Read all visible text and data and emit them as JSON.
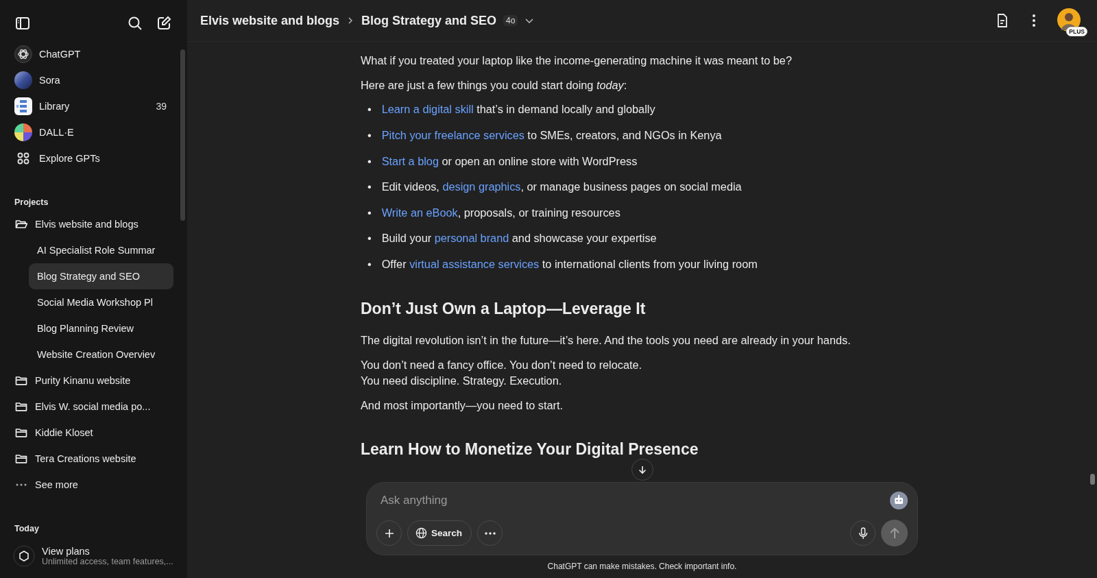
{
  "sidebar": {
    "nav": [
      {
        "kind": "chatgpt",
        "label": "ChatGPT"
      },
      {
        "kind": "sora",
        "label": "Sora"
      },
      {
        "kind": "library",
        "label": "Library",
        "count": "39"
      },
      {
        "kind": "dalle",
        "label": "DALL·E"
      },
      {
        "kind": "explore",
        "label": "Explore GPTs"
      }
    ],
    "projects_heading": "Projects",
    "projects": [
      {
        "label": "Elvis website and blogs",
        "expanded": true,
        "children": [
          {
            "label": "AI Specialist Role Summar",
            "selected": false
          },
          {
            "label": "Blog Strategy and SEO",
            "selected": true
          },
          {
            "label": "Social Media Workshop Pl",
            "selected": false
          },
          {
            "label": "Blog Planning Review",
            "selected": false
          },
          {
            "label": "Website Creation Overviev",
            "selected": false
          }
        ]
      },
      {
        "label": "Purity Kinanu website",
        "expanded": false
      },
      {
        "label": "Elvis W. social media po...",
        "expanded": false
      },
      {
        "label": "Kiddie Kloset",
        "expanded": false
      },
      {
        "label": "Tera Creations website",
        "expanded": false
      }
    ],
    "see_more": "See more",
    "section_heading": "Today",
    "plans": {
      "title": "View plans",
      "subtitle": "Unlimited access, team features,..."
    }
  },
  "header": {
    "breadcrumb": [
      "Elvis website and blogs",
      "Blog Strategy and SEO"
    ],
    "model_badge": "4o",
    "plan_badge": "PLUS"
  },
  "message": [
    {
      "kind": "paragraph",
      "text": "What if you treated your laptop like the income-generating machine it was meant to be?"
    },
    {
      "kind": "paragraph",
      "text": "Here are just a few things you could start doing *today*:"
    },
    {
      "kind": "bullets",
      "marker": "•",
      "items": [
        [
          {
            "text": "Learn a digital skill",
            "link": true
          },
          {
            "text": " that’s in demand locally and globally",
            "link": false
          }
        ],
        [
          {
            "text": "Pitch your freelance services",
            "link": true
          },
          {
            "text": " to SMEs, creators, and NGOs in Kenya",
            "link": false
          }
        ],
        [
          {
            "text": "Start a blog",
            "link": true
          },
          {
            "text": " or open an online store with WordPress",
            "link": false
          }
        ],
        [
          {
            "text": "Edit videos, ",
            "link": false
          },
          {
            "text": "design graphics",
            "link": true
          },
          {
            "text": ", or manage business pages on social media",
            "link": false
          }
        ],
        [
          {
            "text": "Write an eBook",
            "link": true
          },
          {
            "text": ", proposals, or training resources",
            "link": false
          }
        ],
        [
          {
            "text": "Build your ",
            "link": false
          },
          {
            "text": "personal brand",
            "link": true
          },
          {
            "text": " and showcase your expertise",
            "link": false
          }
        ],
        [
          {
            "text": "Offer ",
            "link": false
          },
          {
            "text": "virtual assistance services",
            "link": true
          },
          {
            "text": " to international clients from your living room",
            "link": false
          }
        ]
      ]
    },
    {
      "kind": "heading",
      "text": "Don’t Just Own a Laptop—Leverage It"
    },
    {
      "kind": "paragraph",
      "text": "The digital revolution isn’t in the future—it’s here. And the tools you need are already in your hands."
    },
    {
      "kind": "lines",
      "lines": [
        "You don’t need a fancy office. You don’t need to relocate.",
        "You need discipline. Strategy. Execution."
      ]
    },
    {
      "kind": "paragraph",
      "text": "And most importantly—you need to start."
    },
    {
      "kind": "heading",
      "text": "Learn How to Monetize Your Digital Presence"
    }
  ],
  "composer": {
    "placeholder": "Ask anything",
    "search_label": "Search"
  },
  "footer": "ChatGPT can make mistakes. Check important info."
}
